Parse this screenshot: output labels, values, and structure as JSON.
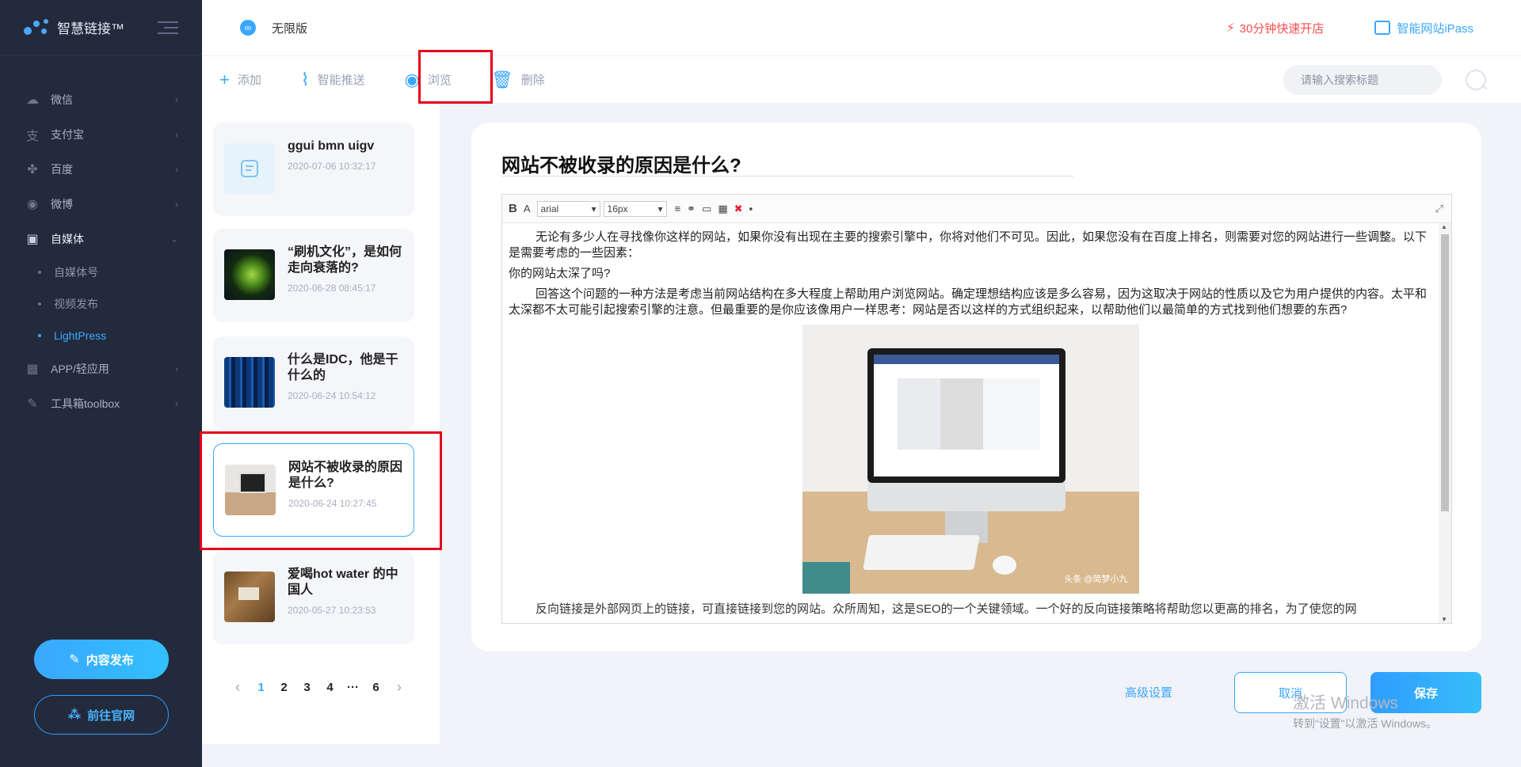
{
  "app": {
    "title": "智慧链接™"
  },
  "sidebar": {
    "items": [
      {
        "label": "微信",
        "icon": "wechat-icon"
      },
      {
        "label": "支付宝",
        "icon": "alipay-icon"
      },
      {
        "label": "百度",
        "icon": "baidu-paw-icon"
      },
      {
        "label": "微博",
        "icon": "weibo-icon"
      },
      {
        "label": "自媒体",
        "icon": "camera-icon"
      },
      {
        "label": "APP/轻应用",
        "icon": "app-grid-icon"
      },
      {
        "label": "工具箱toolbox",
        "icon": "wrench-icon"
      }
    ],
    "sub_items": [
      "自媒体号",
      "视频发布",
      "LightPress"
    ],
    "publish_label": "内容发布",
    "official_label": "前往官网"
  },
  "header": {
    "version": "无限版",
    "quick_open": "30分钟快速开店",
    "ipass": "智能网站iPass"
  },
  "toolbar": {
    "add": "添加",
    "push": "智能推送",
    "browse": "浏览",
    "delete": "删除",
    "search_placeholder": "请输入搜索标题"
  },
  "articles": [
    {
      "title": "ggui bmn uigv",
      "date": "2020-07-06 10:32:17"
    },
    {
      "title": "“刷机文化”，是如何走向衰落的?",
      "date": "2020-06-28 08:45:17"
    },
    {
      "title": "什么是IDC，他是干什么的",
      "date": "2020-06-24 10:54:12"
    },
    {
      "title": "网站不被收录的原因是什么?",
      "date": "2020-06-24 10:27:45"
    },
    {
      "title": "爱喝hot water 的中国人",
      "date": "2020-05-27 10:23:53"
    }
  ],
  "pagination": {
    "pages": [
      "1",
      "2",
      "3",
      "4",
      "···",
      "6"
    ],
    "current": "1"
  },
  "editor": {
    "title_value": "网站不被收录的原因是什么?",
    "font_family": "arial",
    "font_size": "16px",
    "toolbar_bold": "B",
    "toolbar_fontcolor": "A",
    "para1": "无论有多少人在寻找像你这样的网站，如果你没有出现在主要的搜索引擎中，你将对他们不可见。因此，如果您没有在百度上排名，则需要对您的网站进行一些调整。以下是需要考虑的一些因素：",
    "para2": "你的网站太深了吗?",
    "para3": "回答这个问题的一种方法是考虑当前网站结构在多大程度上帮助用户浏览网站。确定理想结构应该是多么容易，因为这取决于网站的性质以及它为用户提供的内容。太平和太深都不太可能引起搜索引擎的注意。但最重要的是你应该像用户一样思考：网站是否以这样的方式组织起来，以帮助他们以最简单的方式找到他们想要的东西?",
    "image_watermark": "头条 @简梦小九",
    "cut_text": "反向链接是外部网页上的链接，可直接链接到您的网站。众所周知，这是SEO的一个关键领域。一个好的反向链接策略将帮助您以更高的排名，为了使您的网"
  },
  "actions": {
    "advanced": "高级设置",
    "cancel": "取消",
    "save": "保存"
  },
  "watermark": {
    "line1": "激活 Windows",
    "line2": "转到“设置”以激活 Windows。"
  }
}
